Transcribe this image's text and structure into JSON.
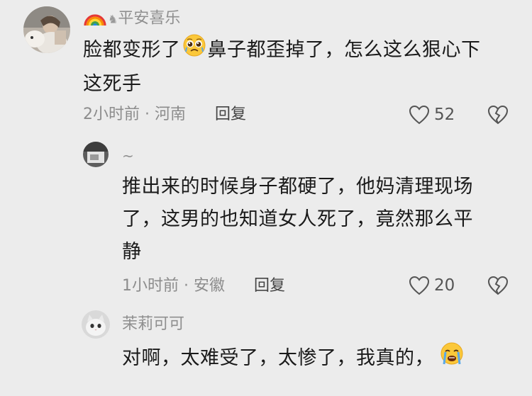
{
  "comments": [
    {
      "username": "平安喜乐",
      "lines": [
        "脸都变形了",
        "鼻子都歪掉了，怎么这么狠心下",
        "这死手"
      ],
      "time": "2小时前",
      "location": "河南",
      "reply_label": "回复",
      "likes": "52"
    },
    {
      "username": "~",
      "lines": [
        "推出来的时候身子都硬了，他妈清理现场",
        "了，这男的也知道女人死了，竟然那么平",
        "静"
      ],
      "time": "1小时前",
      "location": "安徽",
      "reply_label": "回复",
      "likes": "20"
    },
    {
      "username": "茉莉可可",
      "lines": [
        "对啊，太难受了，太惨了，我真的，"
      ]
    }
  ],
  "separator": " · ",
  "icons": {
    "like": "heart-outline-icon",
    "dislike": "broken-heart-icon",
    "rainbow": "rainbow-emoji-icon",
    "cry_face": "pleading-face-emoji-icon",
    "sob_face": "loudly-crying-face-emoji-icon"
  }
}
